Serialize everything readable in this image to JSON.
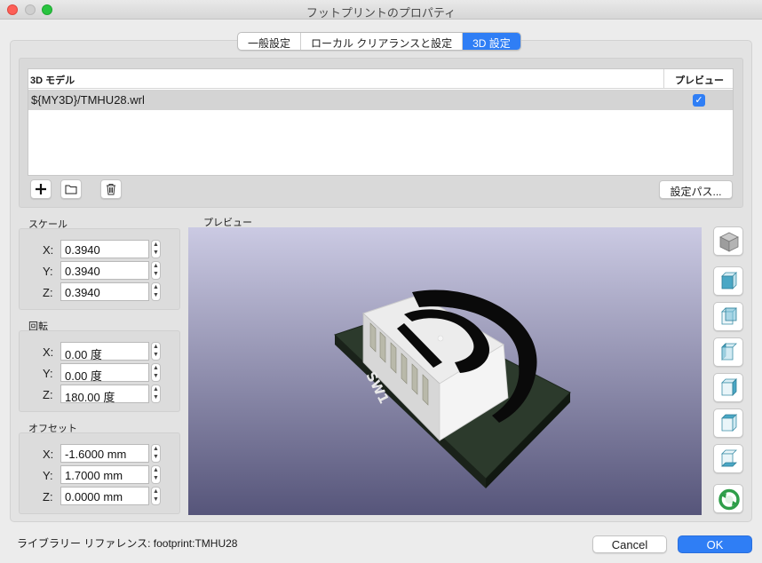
{
  "window": {
    "title": "フットプリントのプロパティ"
  },
  "tabs": [
    {
      "label": "一般設定",
      "active": false
    },
    {
      "label": "ローカル クリアランスと設定",
      "active": false
    },
    {
      "label": "3D 設定",
      "active": true
    }
  ],
  "model_table": {
    "headers": {
      "model": "3D モデル",
      "preview": "プレビュー"
    },
    "rows": [
      {
        "path": "${MY3D}/TMHU28.wrl",
        "preview_checked": true
      }
    ]
  },
  "toolbar": {
    "add_icon": "plus-icon",
    "open_icon": "folder-icon",
    "delete_icon": "trash-icon",
    "settings_path_label": "設定パス..."
  },
  "scale": {
    "label": "スケール",
    "x_label": "X:",
    "x": "0.3940",
    "y_label": "Y:",
    "y": "0.3940",
    "z_label": "Z:",
    "z": "0.3940"
  },
  "rotation": {
    "label": "回転",
    "x_label": "X:",
    "x": "0.00 度",
    "y_label": "Y:",
    "y": "0.00 度",
    "z_label": "Z:",
    "z": "180.00 度"
  },
  "offset": {
    "label": "オフセット",
    "x_label": "X:",
    "x": "-1.6000 mm",
    "y_label": "Y:",
    "y": "1.7000 mm",
    "z_label": "Z:",
    "z": "0.0000 mm"
  },
  "preview": {
    "label": "プレビュー",
    "silkscreen_text": "SW1"
  },
  "view_buttons": [
    "cube-view-icon",
    "cube-front-icon",
    "cube-back-icon",
    "cube-left-icon",
    "cube-right-icon",
    "cube-top-icon",
    "cube-bottom-icon",
    "reload-icon"
  ],
  "footer": {
    "library_reference": "ライブラリー リファレンス:  footprint:TMHU28",
    "cancel_label": "Cancel",
    "ok_label": "OK"
  },
  "colors": {
    "accent": "#2f7ef5",
    "viewport_top": "#cbcae3",
    "viewport_bottom": "#56557a",
    "pcb": "#2c3a2c"
  }
}
